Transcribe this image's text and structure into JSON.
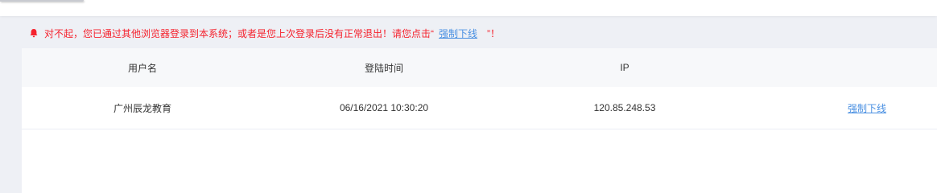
{
  "alert": {
    "icon": "bell-icon",
    "message": "对不起，您已通过其他浏览器登录到本系统；或者是您上次登录后没有正常退出！请您点击“",
    "link_text": "强制下线",
    "suffix": "”！",
    "color": "#f5222d"
  },
  "table": {
    "headers": [
      "用户名",
      "登陆时间",
      "IP",
      ""
    ],
    "rows": [
      {
        "username": "广州辰龙教育",
        "login_time": "06/16/2021 10:30:20",
        "ip": "120.85.248.53",
        "action": "强制下线"
      }
    ]
  },
  "colors": {
    "link": "#4a90e2",
    "header_bg": "#f7f8fa",
    "page_bg": "#eef0f5"
  }
}
